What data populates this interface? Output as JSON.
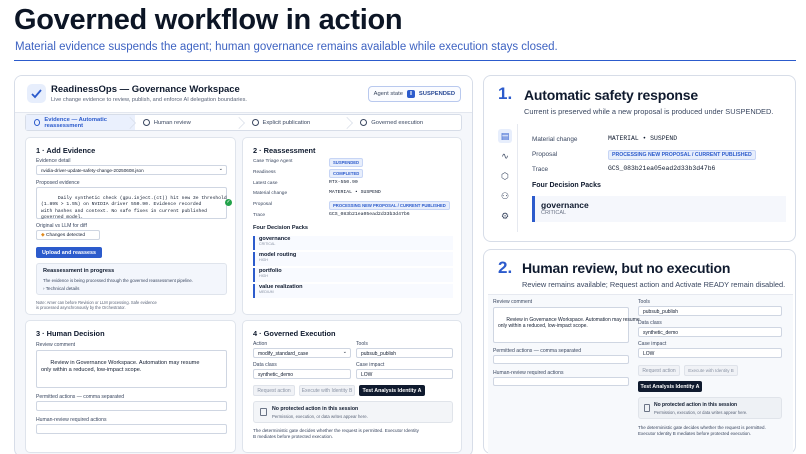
{
  "headline": "Governed workflow in action",
  "subline": "Material evidence suspends the agent; human governance remains available while execution stays closed.",
  "app": {
    "title": "ReadinessOps — Governance Workspace",
    "subtitle": "Live change evidence to review, publish, and enforce AI delegation boundaries.",
    "agent_state_label": "Agent state",
    "agent_state_value": "SUSPENDED",
    "steps": [
      "Evidence — Automatic reassessment",
      "Human review",
      "Explicit publication",
      "Governed execution"
    ]
  },
  "add_evidence": {
    "title": "1 · Add Evidence",
    "evidence_label": "Evidence detail",
    "evidence_value": "nvidia-driver-update-safety-change-20250608.json",
    "proposed_label": "Proposed evidence",
    "proposed_text": "Daily synthetic check (gpu.inject.(ct)) hit new 3e threshold\n(1.89% > 1.5%) on NVIDIA driver 550.90. Evidence recorded\nwith hashes and context. No safe fixes in current published\ngoverned model.",
    "original_label": "Original vs LLM for diff",
    "changes_detected": "Changes detected",
    "upload_button": "Upload and reassess",
    "reassess_title": "Reassessment in progress",
    "reassess_text": "The evidence is being processed through the governed reassessment pipeline.",
    "technical_details": "Technical details",
    "note": "Note: Amer can before Revision or LLM processing. Safe evidence\nis processed asynchronously by the Orchestrator."
  },
  "reassessment": {
    "title": "2 · Reassessment",
    "rows": [
      {
        "k": "Case Triage Agent",
        "v": "SUSPENDED",
        "pill": true
      },
      {
        "k": "Readiness",
        "v": "COMPLETED",
        "pill": true
      },
      {
        "k": "Latest case",
        "v": "RTX-550.90",
        "pill": false
      },
      {
        "k": "Material change",
        "v": "MATERIAL • SUSPEND",
        "pill": false
      },
      {
        "k": "Proposal",
        "v": "PROCESSING NEW PROPOSAL / CURRENT PUBLISHED",
        "pill": true
      },
      {
        "k": "Trace",
        "v": "GCS_083b21ea05ead2d33b3d47b6",
        "pill": false
      }
    ],
    "packs_title": "Four Decision Packs",
    "packs": [
      {
        "name": "governance",
        "sev": "CRITICAL"
      },
      {
        "name": "model routing",
        "sev": "HIGH"
      },
      {
        "name": "portfolio",
        "sev": "HIGH"
      },
      {
        "name": "value realization",
        "sev": "MEDIUM"
      }
    ]
  },
  "human_decision": {
    "title": "3 · Human Decision",
    "review_label": "Review comment",
    "review_text": "Review in Governance Workspace. Automation may resume\nonly within a reduced, low-impact scope.",
    "permitted_label": "Permitted actions — comma separated",
    "required_label": "Human-review required actions"
  },
  "governed_execution": {
    "title": "4 · Governed Execution",
    "action_label": "Action",
    "action_value": "modify_standard_case",
    "tools_label": "Tools",
    "tools_value": "pubsub_publish",
    "data_class_label": "Data class",
    "data_class_value": "synthetic_demo",
    "impact_label": "Case impact",
    "impact_value": "LOW",
    "request_button": "Request action",
    "execute_button": "Execute with Identity B",
    "test_button": "Test Analysis Identity A",
    "no_action_title": "No protected action in this session",
    "no_action_text": "Permission, execution, or data writes appear here.",
    "footer": "The deterministic gate decides whether the request is permitted. Executor Identity\nB mediates before protected execution."
  },
  "card1": {
    "num": "1.",
    "title": "Automatic safety response",
    "sub": "Current is preserved while a new proposal is produced under SUSPENDED.",
    "rows": [
      {
        "k": "Material change",
        "v": "MATERIAL • SUSPEND",
        "pill": false
      },
      {
        "k": "Proposal",
        "v": "PROCESSING NEW PROPOSAL / CURRENT PUBLISHED",
        "pill": true
      },
      {
        "k": "Trace",
        "v": "GCS_083b21ea05ead2d33b3d47b6",
        "pill": false
      }
    ],
    "packs_title": "Four Decision Packs",
    "pack_name": "governance",
    "pack_sev": "CRITICAL"
  },
  "card2": {
    "num": "2.",
    "title": "Human review, but no execution",
    "sub": "Review remains available; Request action and Activate READY remain disabled.",
    "review_label": "Review comment",
    "review_text": "Review in Governance Workspace. Automation may resume\nonly within a reduced, low-impact scope.",
    "permitted_label": "Permitted actions — comma separated",
    "required_label": "Human-review required actions",
    "tools_label": "Tools",
    "tools_value": "pubsub_publish",
    "data_class_label": "Data class",
    "data_class_value": "synthetic_demo",
    "impact_label": "Case impact",
    "impact_value": "LOW",
    "request_button": "Request action",
    "execute_button": "Execute with Identity B",
    "test_button": "Test Analysis Identity A",
    "no_action_title": "No protected action in this session",
    "no_action_text": "Permission, execution, or data writes appear here.",
    "footer": "The deterministic gate decides whether the request is permitted.\nExecutor Identity B mediates before protected execution."
  }
}
